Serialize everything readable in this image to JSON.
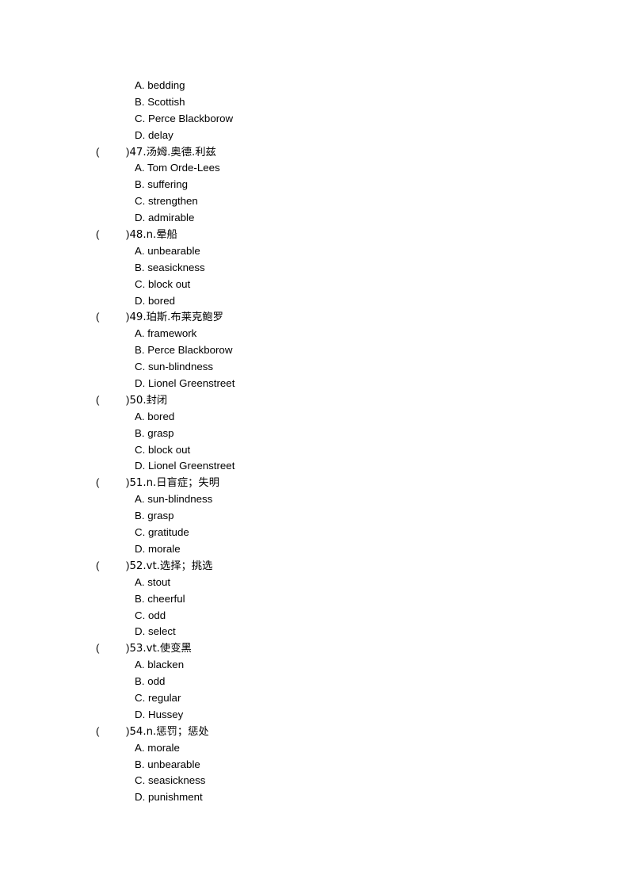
{
  "document": {
    "page_background": "#ffffff",
    "text_color": "#000000",
    "type": "vocabulary-multiple-choice-worksheet",
    "paren_open": "(",
    "paren_close": ")"
  },
  "blocks": [
    {
      "kind": "orphan-options",
      "options": [
        "A. bedding",
        "B. Scottish",
        "C. Perce Blackborow",
        "D. delay"
      ]
    },
    {
      "kind": "question",
      "number": "47",
      "stem": "47.汤姆.奥德.利兹",
      "options": [
        "A. Tom Orde-Lees",
        "B. suffering",
        "C. strengthen",
        "D. admirable"
      ]
    },
    {
      "kind": "question",
      "number": "48",
      "stem": "48.n.晕船",
      "options": [
        "A. unbearable",
        "B. seasickness",
        "C. block out",
        "D. bored"
      ]
    },
    {
      "kind": "question",
      "number": "49",
      "stem": "49.珀斯.布莱克鲍罗",
      "options": [
        "A. framework",
        "B. Perce Blackborow",
        "C. sun-blindness",
        "D. Lionel Greenstreet"
      ]
    },
    {
      "kind": "question",
      "number": "50",
      "stem": "50.封闭",
      "options": [
        "A. bored",
        "B. grasp",
        "C. block out",
        "D. Lionel Greenstreet"
      ]
    },
    {
      "kind": "question",
      "number": "51",
      "stem": "51.n.日盲症；失明",
      "options": [
        "A. sun-blindness",
        "B. grasp",
        "C. gratitude",
        "D. morale"
      ]
    },
    {
      "kind": "question",
      "number": "52",
      "stem": "52.vt.选择；挑选",
      "options": [
        "A. stout",
        "B. cheerful",
        "C. odd",
        "D. select"
      ]
    },
    {
      "kind": "question",
      "number": "53",
      "stem": "53.vt.使变黑",
      "options": [
        "A. blacken",
        "B. odd",
        "C. regular",
        "D. Hussey"
      ]
    },
    {
      "kind": "question",
      "number": "54",
      "stem": "54.n.惩罚；惩处",
      "options": [
        "A. morale",
        "B. unbearable",
        "C. seasickness",
        "D. punishment"
      ]
    }
  ]
}
